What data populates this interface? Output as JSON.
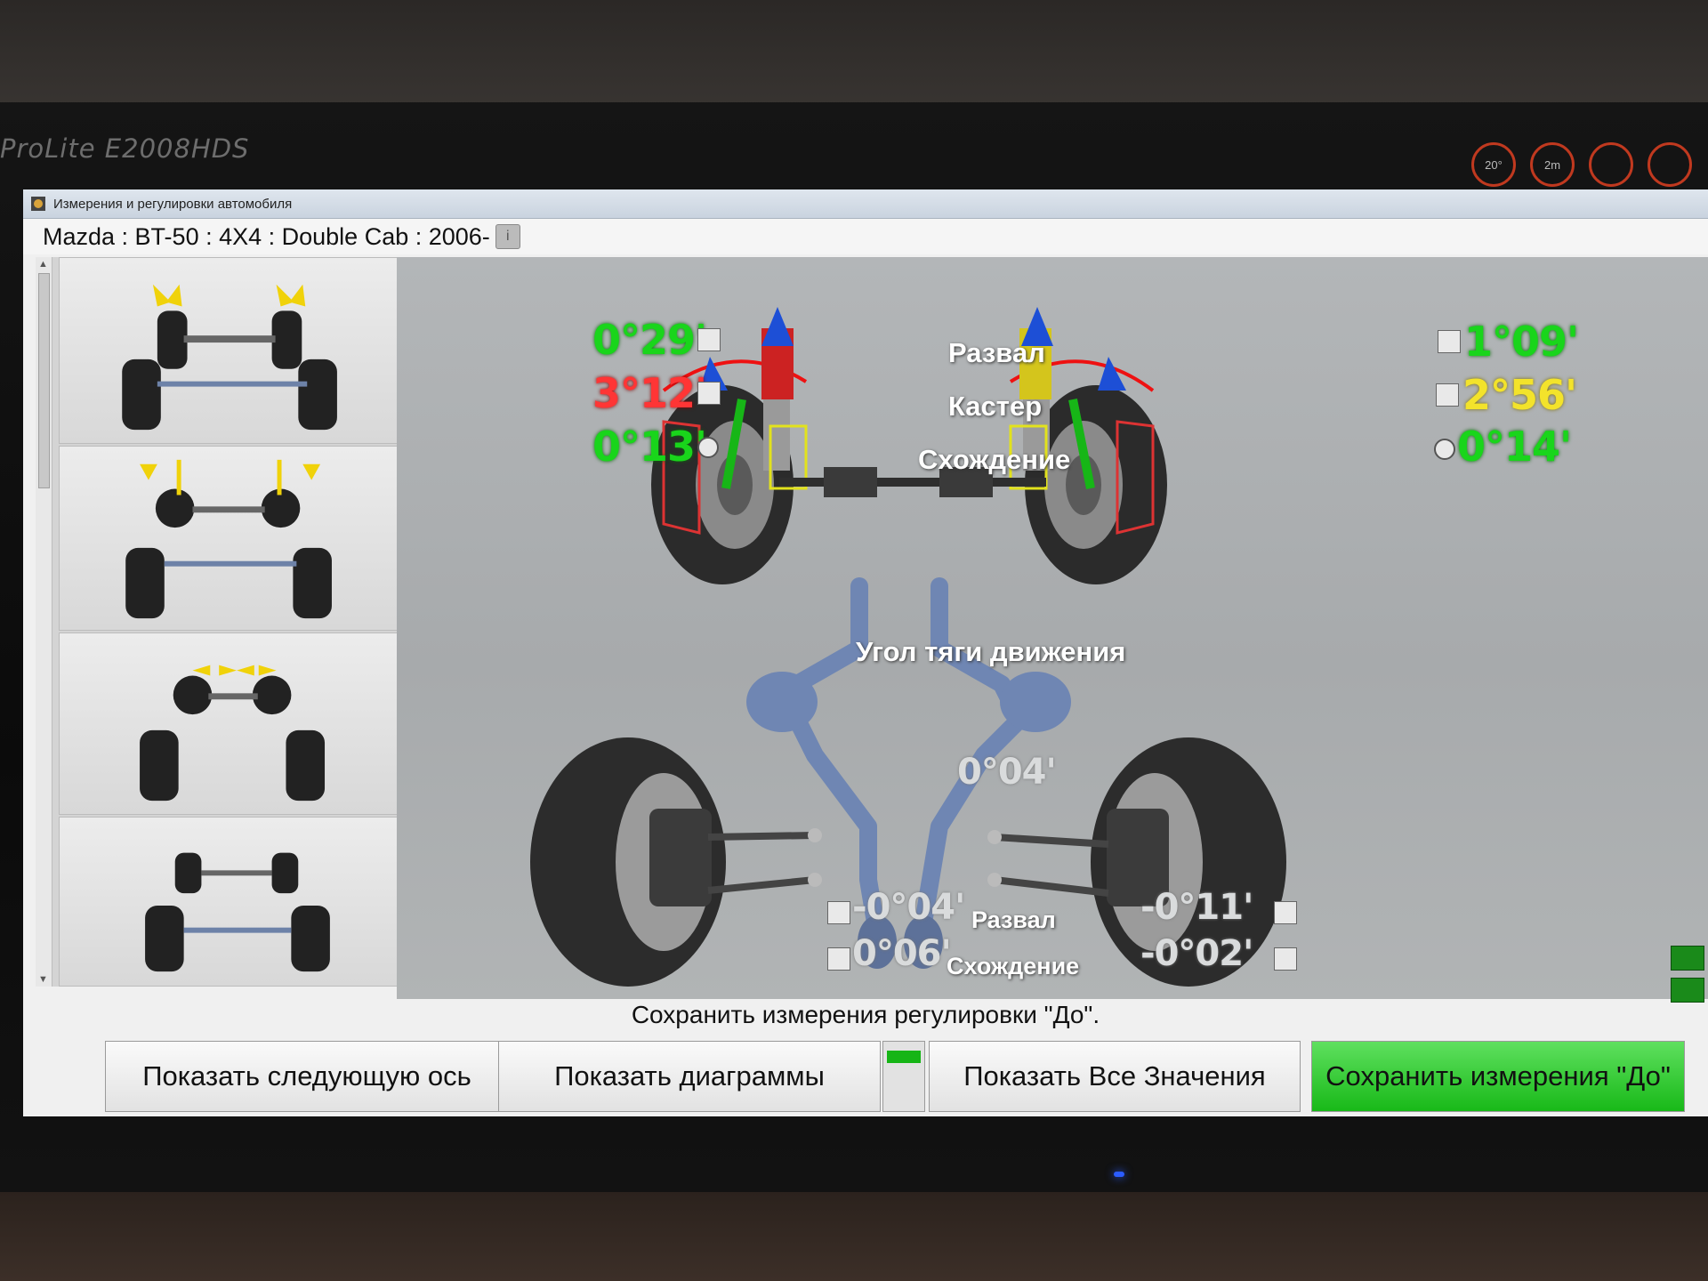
{
  "monitor": {
    "model": "ProLite E2008HDS",
    "bezel_buttons": [
      "20°",
      "2m",
      "",
      ""
    ]
  },
  "window": {
    "title": "Измерения и регулировки автомобиля",
    "vehicle": "Mazda : BT-50 : 4X4 : Double Cab : 2006-"
  },
  "front_axle": {
    "left": {
      "camber": "0°29'",
      "caster": "3°12'",
      "toe": "0°13'"
    },
    "right": {
      "camber": "1°09'",
      "caster": "2°56'",
      "toe": "0°14'"
    },
    "labels": {
      "camber": "Развал",
      "caster": "Кастер",
      "toe": "Схождение"
    }
  },
  "thrust": {
    "label": "Угол тяги движения",
    "value": "0°04'"
  },
  "rear_axle": {
    "left": {
      "camber": "-0°04'",
      "toe": "0°06'"
    },
    "right": {
      "camber": "-0°11'",
      "toe": "-0°02'"
    },
    "labels": {
      "camber": "Развал",
      "toe": "Схождение"
    }
  },
  "status": "Сохранить измерения регулировки \"До\".",
  "buttons": {
    "next_axle": "Показать следующую ось",
    "diagrams": "Показать диаграммы",
    "all_values": "Показать Все Значения",
    "save_before": "Сохранить  измерения \"До\""
  },
  "colors": {
    "in_tolerance": "#19d51b",
    "out_of_tolerance": "#ff3535",
    "warning": "#f3e32b",
    "save_button": "#18b918"
  }
}
